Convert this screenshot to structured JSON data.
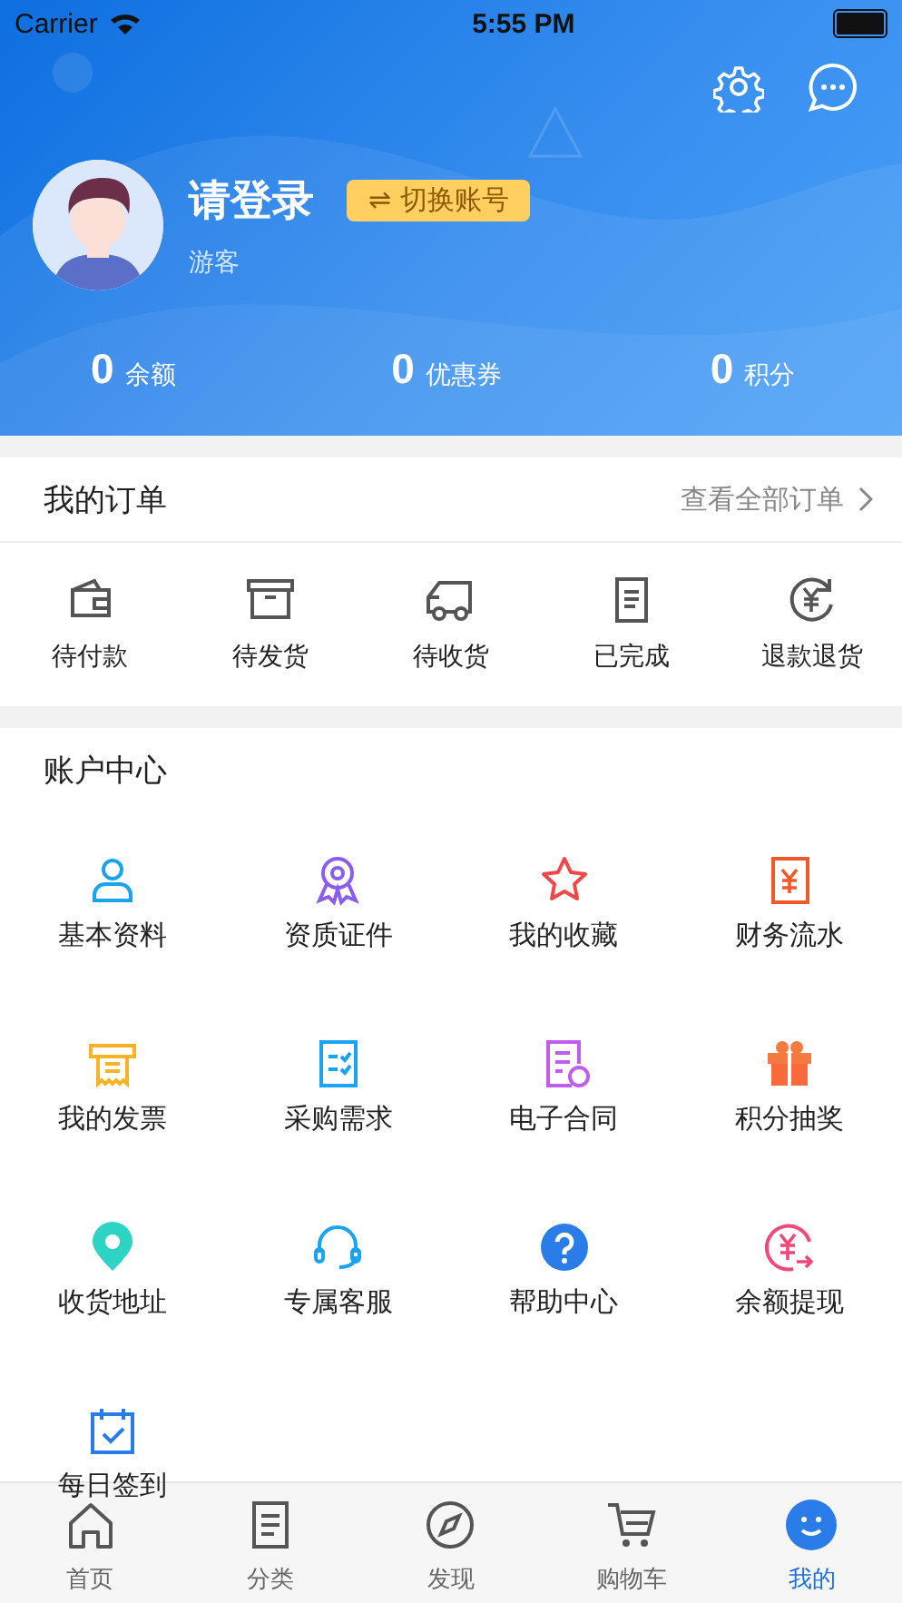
{
  "status_bar": {
    "carrier": "Carrier",
    "time": "5:55 PM"
  },
  "profile": {
    "name": "请登录",
    "switch_button": "⇌ 切换账号",
    "role": "游客"
  },
  "stats": [
    {
      "value": "0",
      "label": "余额"
    },
    {
      "value": "0",
      "label": "优惠券"
    },
    {
      "value": "0",
      "label": "积分"
    }
  ],
  "orders": {
    "title": "我的订单",
    "view_all": "查看全部订单",
    "items": [
      "待付款",
      "待发货",
      "待收货",
      "已完成",
      "退款退货"
    ]
  },
  "account_center": {
    "title": "账户中心",
    "items": [
      "基本资料",
      "资质证件",
      "我的收藏",
      "财务流水",
      "我的发票",
      "采购需求",
      "电子合同",
      "积分抽奖",
      "收货地址",
      "专属客服",
      "帮助中心",
      "余额提现",
      "每日签到"
    ]
  },
  "tab_bar": [
    {
      "label": "首页",
      "selected": false
    },
    {
      "label": "分类",
      "selected": false
    },
    {
      "label": "发现",
      "selected": false
    },
    {
      "label": "购物车",
      "selected": false
    },
    {
      "label": "我的",
      "selected": true
    }
  ]
}
